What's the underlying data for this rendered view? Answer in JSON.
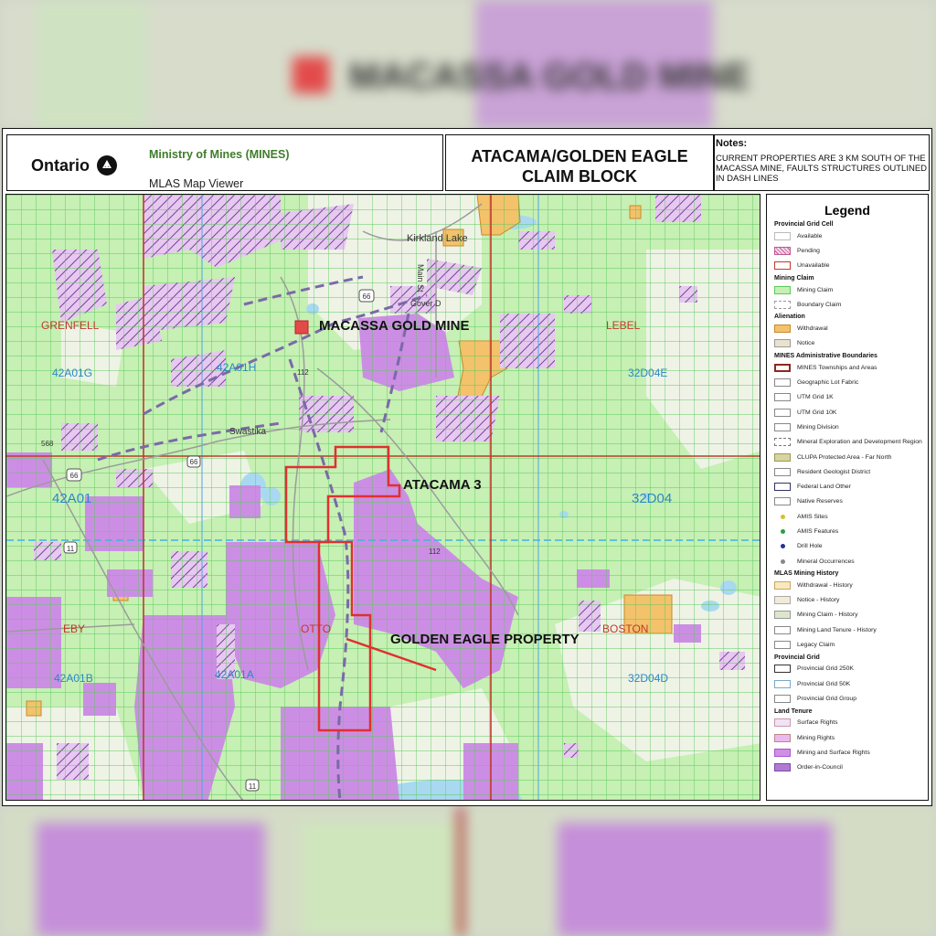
{
  "header": {
    "ontario": "Ontario",
    "ministry": "Ministry of Mines (MINES)",
    "viewer": "MLAS Map Viewer",
    "title_line1": "ATACAMA/GOLDEN EAGLE",
    "title_line2": "CLAIM BLOCK",
    "notes_heading": "Notes:",
    "notes_text": "CURRENT PROPERTIES ARE 3 KM SOUTH OF THE MACASSA MINE, FAULTS STRUCTURES OUTLINED IN DASH LINES"
  },
  "background_title": "MACASSA GOLD MINE",
  "map": {
    "feature_labels": {
      "macassa": "MACASSA GOLD MINE",
      "atacama": "ATACAMA 3",
      "golden_eagle": "GOLDEN EAGLE PROPERTY"
    },
    "townships": [
      "GRENFELL",
      "LEBEL",
      "EBY",
      "OTTO",
      "BOSTON"
    ],
    "grid_labels": [
      "42A01G",
      "42A01H",
      "32D04E",
      "42A01",
      "32D04",
      "42A01B",
      "42A01A",
      "32D04D"
    ],
    "places": [
      "Kirkland Lake",
      "Swastika",
      "Main St",
      "Gover D"
    ],
    "road_numbers": [
      "66",
      "112",
      "66",
      "66",
      "11",
      "11",
      "112",
      "568"
    ],
    "colors": {
      "mining_claim": "#c6f0b4",
      "grid_lines": "#5cc95c",
      "township_lines": "#c0392b",
      "order_in_council": "#cc8ee4",
      "withdrawal": "#f3c26b",
      "property_outline": "#e03030",
      "fault_lines": "#7b69a8"
    }
  },
  "legend": {
    "title": "Legend",
    "sections": [
      {
        "heading": "Provincial Grid Cell",
        "items": [
          {
            "label": "Available",
            "swatch": "available"
          },
          {
            "label": "Pending",
            "swatch": "pending"
          },
          {
            "label": "Unavailable",
            "swatch": "unavailable"
          }
        ]
      },
      {
        "heading": "Mining Claim",
        "items": [
          {
            "label": "Mining Claim",
            "swatch": "mining-claim"
          },
          {
            "label": "Boundary Claim",
            "swatch": "boundary-claim"
          }
        ]
      },
      {
        "heading": "Alienation",
        "items": [
          {
            "label": "Withdrawal",
            "swatch": "withdrawal"
          },
          {
            "label": "Notice",
            "swatch": "notice"
          }
        ]
      },
      {
        "heading": "MINES Administrative Boundaries",
        "items": [
          {
            "label": "MINES Townships and Areas",
            "swatch": "townships"
          },
          {
            "label": "Geographic Lot Fabric",
            "swatch": "plain"
          },
          {
            "label": "UTM Grid 1K",
            "swatch": "plain"
          },
          {
            "label": "UTM Grid 10K",
            "swatch": "plain"
          },
          {
            "label": "Mining Division",
            "swatch": "plain"
          },
          {
            "label": "Mineral Exploration and Development Region",
            "swatch": "dashed"
          },
          {
            "label": "CLUPA Protected Area - Far North",
            "swatch": "clupa"
          },
          {
            "label": "Resident Geologist District",
            "swatch": "plain"
          },
          {
            "label": "Federal Land Other",
            "swatch": "federal"
          },
          {
            "label": "Native Reserves",
            "swatch": "plain"
          },
          {
            "label": "AMIS Sites",
            "swatch": "amis-site"
          },
          {
            "label": "AMIS Features",
            "swatch": "amis-feature"
          },
          {
            "label": "Drill Hole",
            "swatch": "drill"
          },
          {
            "label": "Mineral Occurrences",
            "swatch": "occurrence"
          }
        ]
      },
      {
        "heading": "MLAS Mining History",
        "items": [
          {
            "label": "Withdrawal - History",
            "swatch": "hist-withdrawal"
          },
          {
            "label": "Notice - History",
            "swatch": "hist-notice"
          },
          {
            "label": "Mining Claim - History",
            "swatch": "hist-claim"
          },
          {
            "label": "Mining Land Tenure - History",
            "swatch": "plain"
          },
          {
            "label": "Legacy Claim",
            "swatch": "plain"
          }
        ]
      },
      {
        "heading": "Provincial Grid",
        "items": [
          {
            "label": "Provincial Grid 250K",
            "swatch": "grid250"
          },
          {
            "label": "Provincial Grid 50K",
            "swatch": "grid50"
          },
          {
            "label": "Provincial Grid Group",
            "swatch": "plain"
          }
        ]
      },
      {
        "heading": "Land Tenure",
        "items": [
          {
            "label": "Surface Rights",
            "swatch": "surface"
          },
          {
            "label": "Mining Rights",
            "swatch": "mining-rights"
          },
          {
            "label": "Mining and Surface Rights",
            "swatch": "mining-surface"
          },
          {
            "label": "Order-in-Council",
            "swatch": "oic"
          }
        ]
      }
    ]
  }
}
